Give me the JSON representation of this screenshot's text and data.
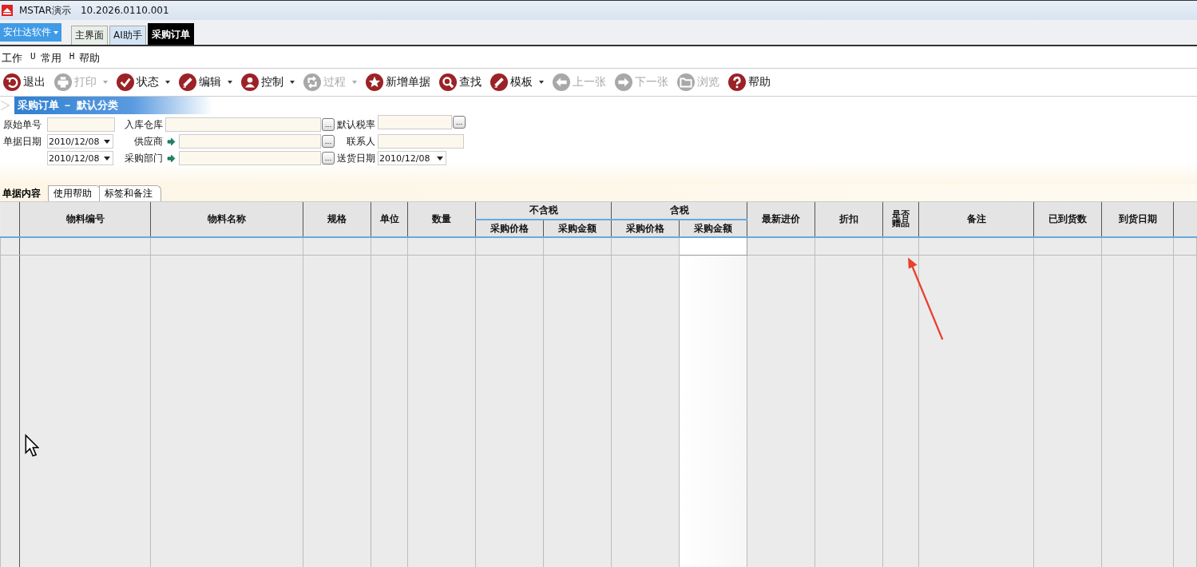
{
  "window": {
    "title": "MSTAR演示",
    "version": "10.2026.0110.001"
  },
  "app_tabs": {
    "brand": "安仕达软件",
    "tabs": [
      {
        "label": "主界面",
        "selected": false,
        "kind": "plain"
      },
      {
        "label": "AI助手",
        "selected": false,
        "kind": "tinted"
      },
      {
        "label": "采购订单",
        "selected": true,
        "kind": "plain"
      }
    ]
  },
  "menu": [
    {
      "label": "工作"
    },
    {
      "key": "U",
      "label": "常用"
    },
    {
      "key": "H",
      "label": "帮助"
    }
  ],
  "toolbar": [
    {
      "kind": "exit",
      "label": "退出",
      "disabled": false,
      "dropdown": false
    },
    {
      "kind": "print",
      "label": "打印",
      "disabled": true,
      "dropdown": true
    },
    {
      "kind": "check",
      "label": "状态",
      "disabled": false,
      "dropdown": true
    },
    {
      "kind": "edit",
      "label": "编辑",
      "disabled": false,
      "dropdown": true
    },
    {
      "kind": "person",
      "label": "控制",
      "disabled": false,
      "dropdown": true
    },
    {
      "kind": "refresh",
      "label": "过程",
      "disabled": true,
      "dropdown": true
    },
    {
      "kind": "star",
      "label": "新增单据",
      "disabled": false,
      "dropdown": false
    },
    {
      "kind": "search",
      "label": "查找",
      "disabled": false,
      "dropdown": false
    },
    {
      "kind": "edit",
      "label": "模板",
      "disabled": false,
      "dropdown": true
    },
    {
      "kind": "prev",
      "label": "上一张",
      "disabled": true,
      "dropdown": false
    },
    {
      "kind": "next",
      "label": "下一张",
      "disabled": true,
      "dropdown": false
    },
    {
      "kind": "folder",
      "label": "浏览",
      "disabled": true,
      "dropdown": false
    },
    {
      "kind": "help",
      "label": "帮助",
      "disabled": false,
      "dropdown": false
    }
  ],
  "section_title": "采购订单 － 默认分类",
  "form": [
    {
      "label": "原始单号",
      "kind": "text",
      "linked": false
    },
    {
      "label": "入库仓库",
      "kind": "lookup",
      "linked": false,
      "button": "..."
    },
    {
      "label": "默认税率",
      "kind": "lookup",
      "linked": false,
      "button": "..."
    },
    {
      "label": "单据日期",
      "kind": "date",
      "value": "2010/12/08",
      "linked": false
    },
    {
      "label": "供应商",
      "kind": "lookup",
      "linked": true,
      "button": "..."
    },
    {
      "label": "联系人",
      "kind": "text",
      "linked": false
    },
    {
      "kind": "date",
      "value": "2010/12/08",
      "linked": false
    },
    {
      "label": "采购部门",
      "kind": "lookup",
      "linked": true,
      "button": "..."
    },
    {
      "label": "送货日期",
      "kind": "date",
      "value": "2010/12/08",
      "linked": false
    }
  ],
  "detail_tabs": [
    {
      "label": "单据内容",
      "selected": true
    },
    {
      "label": "使用帮助",
      "selected": false
    },
    {
      "label": "标签和备注",
      "selected": false
    }
  ],
  "table": {
    "columns": [
      {
        "label": "物料编号",
        "selected": false
      },
      {
        "label": "物料名称",
        "selected": false
      },
      {
        "label": "规格",
        "selected": false
      },
      {
        "label": "单位",
        "selected": false
      },
      {
        "label": "数量",
        "selected": false
      },
      {
        "label": "不含税",
        "children": [
          {
            "label": "采购价格",
            "selected": false
          },
          {
            "label": "采购金额",
            "selected": false
          }
        ]
      },
      {
        "label": "含税",
        "children": [
          {
            "label": "采购价格",
            "selected": false
          },
          {
            "label": "采购金额",
            "selected": true
          }
        ]
      },
      {
        "label": "最新进价",
        "selected": false
      },
      {
        "label": "折扣",
        "selected": false
      },
      {
        "label": "是否赠品",
        "selected": false,
        "kind": "narrow"
      },
      {
        "label": "备注",
        "selected": false
      },
      {
        "label": "已到货数",
        "selected": false
      },
      {
        "label": "到货日期",
        "selected": false
      }
    ]
  }
}
